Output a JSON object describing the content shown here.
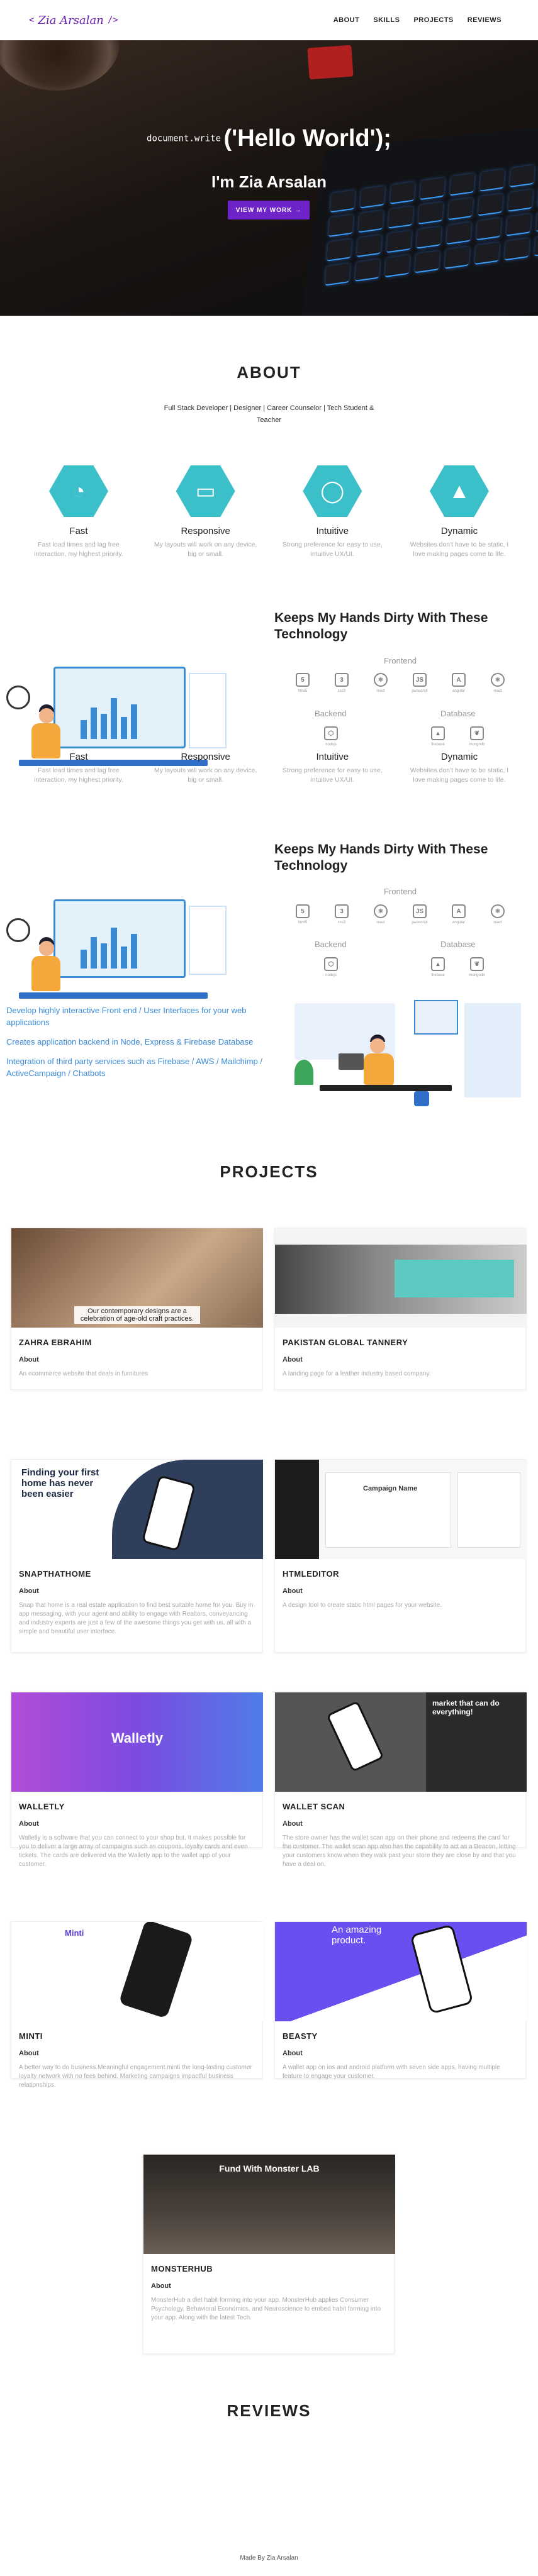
{
  "nav": {
    "logo_bracket_open": "<",
    "logo_name": "Zia Arsalan",
    "logo_bracket_close": "/>",
    "links": [
      "ABOUT",
      "SKILLS",
      "PROJECTS",
      "REVIEWS"
    ]
  },
  "hero": {
    "code_prefix": "document.write",
    "code_text": "('Hello World');",
    "name": "I'm Zia Arsalan",
    "button_label": "VIEW MY WORK",
    "button_arrow": "→"
  },
  "about": {
    "title": "ABOUT",
    "subtitle": "Full Stack Developer | Designer | Career Counselor | Tech Student & Teacher",
    "features": [
      {
        "icon": "speedometer-icon",
        "glyph": "◔",
        "title": "Fast",
        "desc": "Fast load times and lag free interaction, my highest priority."
      },
      {
        "icon": "devices-icon",
        "glyph": "▭",
        "title": "Responsive",
        "desc": "My layouts will work on any device, big or small."
      },
      {
        "icon": "lightbulb-icon",
        "glyph": "◯",
        "title": "Intuitive",
        "desc": "Strong preference for easy to use, intuitive UX/UI."
      },
      {
        "icon": "rocket-icon",
        "glyph": "▲",
        "title": "Dynamic",
        "desc": "Websites don't have to be static, I love making pages come to life."
      }
    ]
  },
  "skills": {
    "title": "Keeps My Hands Dirty With These Technology",
    "frontend_label": "Frontend",
    "backend_label": "Backend",
    "database_label": "Database",
    "frontend": [
      {
        "name": "html5",
        "glyph": "5"
      },
      {
        "name": "css3",
        "glyph": "3"
      },
      {
        "name": "react",
        "glyph": "⚛"
      },
      {
        "name": "javascript",
        "glyph": "JS"
      },
      {
        "name": "angular",
        "glyph": "A"
      },
      {
        "name": "react",
        "glyph": "⚛"
      }
    ],
    "backend": [
      {
        "name": "nodejs",
        "glyph": "⬡"
      }
    ],
    "database": [
      {
        "name": "firebase",
        "glyph": "▴"
      },
      {
        "name": "mongodb",
        "glyph": "❦"
      }
    ],
    "bullets": [
      "Develop highly interactive Front end / User Interfaces for your web applications",
      "Creates application backend in Node, Express & Firebase Database",
      "Integration of third party services such as Firebase / AWS / Mailchimp / ActiveCampaign / Chatbots"
    ]
  },
  "projects": {
    "title": "PROJECTS",
    "about_label": "About",
    "items": [
      {
        "name": "ZAHRA EBRAHIM",
        "desc": "An ecommerce website that deals in furnitures",
        "caption": "Our contemporary designs are a celebration of age-old craft practices."
      },
      {
        "name": "PAKISTAN GLOBAL TANNERY",
        "desc": "A landing page for a leather industry based company."
      },
      {
        "name": "SNAPTHATHOME",
        "desc": "Snap that home is a real estate application to find best suitable home for you. Buy in app messaging, with your agent and ability to engage with Realtors, conveyancing and industry experts are just a few of the awesome things you get with us, all with a simple and beautiful user interface.",
        "heading": "Finding your first home has never been easier"
      },
      {
        "name": "HTMLEDITOR",
        "desc": "A design tool to create static html pages for your website.",
        "heading": "Campaign Name"
      },
      {
        "name": "WALLETLY",
        "desc": "Walletly is a software that you can connect to your shop but. It makes possible for you to deliver a large array of campaigns such as coupons, loyalty cards and even tickets. The cards are delivered via the Walletly app to the wallet app of your customer.",
        "heading": "Walletly"
      },
      {
        "name": "WALLET SCAN",
        "desc": "The store owner has the wallet scan app on their phone and redeems the card for the customer. The wallet scan app also has the capability to act as a Beacon, letting your customers know when they walk past your store they are close by and that you have a deal on.",
        "heading": "market that can do everything!"
      },
      {
        "name": "MINTI",
        "desc": "A better way to do business.Meaningful engagement.minti the long-lasting customer loyalty network with no fees behind. Marketing campaigns impactful business relationships.",
        "heading": "Minti"
      },
      {
        "name": "BEASTY",
        "desc": "A wallet app on ios and android platform with seven side apps, having multiple feature to engage your customer.",
        "heading": "An amazing product."
      },
      {
        "name": "MONSTERHUB",
        "desc": "MonsterHub a diet habit forming into your app. MonsterHub applies Consumer Psychology, Behavioral Economics, and Neuroscience to embed habit forming into your app. Along with the latest Tech.",
        "heading": "Fund With Monster LAB"
      }
    ]
  },
  "reviews": {
    "title": "REVIEWS"
  },
  "footer": {
    "text": "Made By Zia Arsalan"
  }
}
